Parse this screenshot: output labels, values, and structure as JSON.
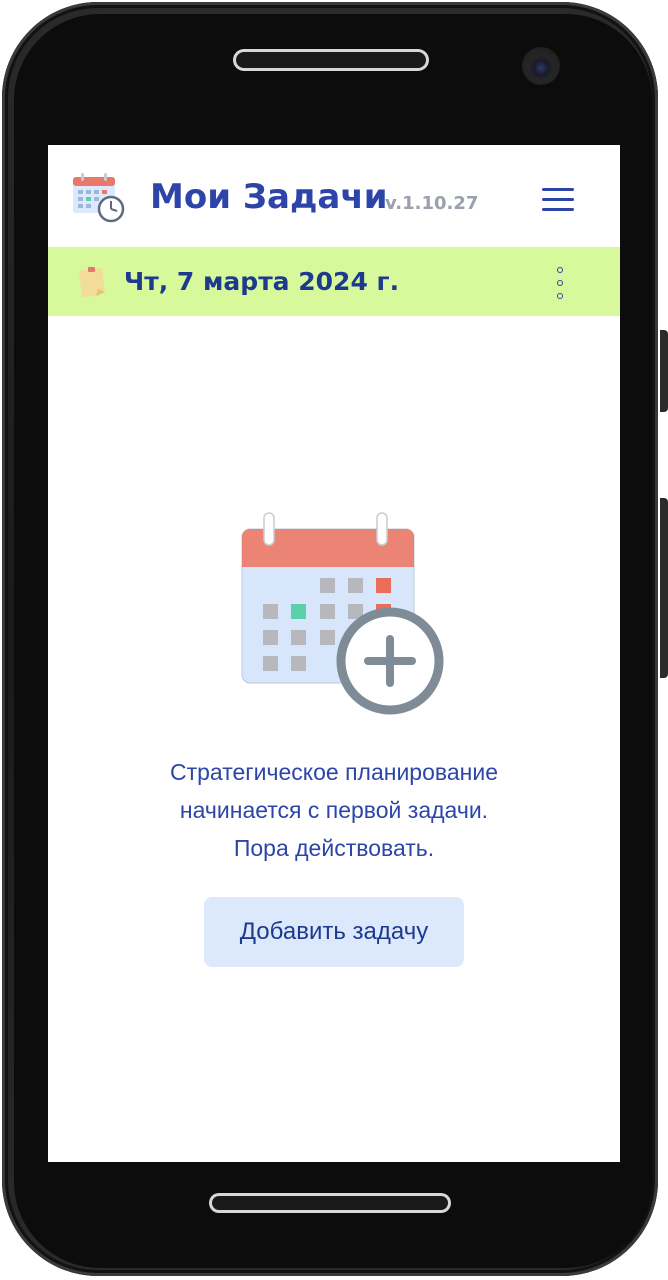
{
  "app": {
    "title": "Мои Задачи",
    "version": "v.1.10.27",
    "logo_icon": "calendar-clock-icon",
    "menu_icon": "hamburger-menu-icon"
  },
  "date_bar": {
    "date": "Чт, 7 марта 2024 г.",
    "note_icon": "sticky-note-icon",
    "more_icon": "more-vertical-icon"
  },
  "empty_state": {
    "illustration": "calendar-add-icon",
    "lines": [
      "Стратегическое планирование",
      "начинается с первой задачи.",
      "Пора действовать."
    ],
    "button_label": "Добавить задачу"
  },
  "colors": {
    "brand": "#2d45a8",
    "date_bar_bg": "#d7f99b",
    "button_bg": "#dce9fc"
  }
}
